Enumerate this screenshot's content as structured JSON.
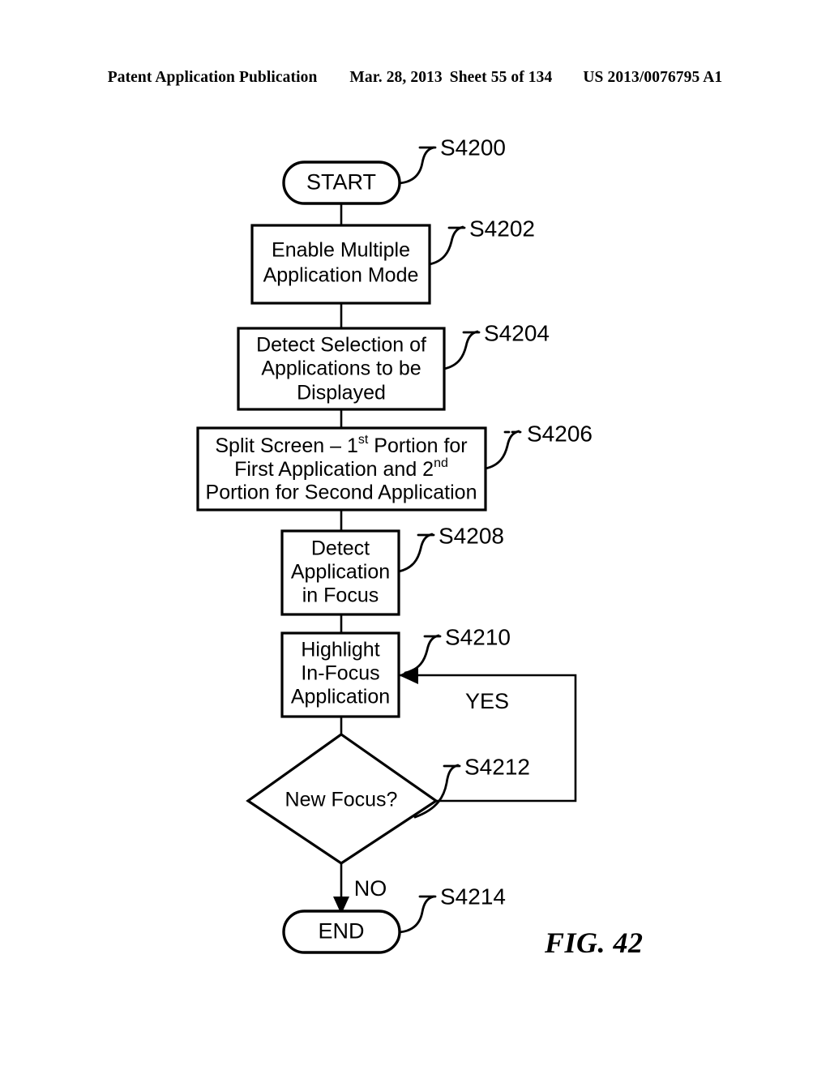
{
  "header": {
    "publication": "Patent Application Publication",
    "date": "Mar. 28, 2013",
    "sheet": "Sheet 55 of 134",
    "patent_number": "US 2013/0076795 A1"
  },
  "figure": {
    "caption": "FIG. 42"
  },
  "flowchart": {
    "nodes": {
      "start": {
        "label": "START",
        "step": "S4200"
      },
      "enable_mode": {
        "line1": "Enable Multiple",
        "line2": "Application Mode",
        "step": "S4202"
      },
      "detect_selection": {
        "line1": "Detect Selection of",
        "line2": "Applications to be",
        "line3": "Displayed",
        "step": "S4204"
      },
      "split_screen": {
        "line1_a": "Split Screen ",
        "line1_b": "– 1",
        "line1_sup": "st",
        "line1_c": " Portion for",
        "line2_a": "First Application and 2",
        "line2_sup": "nd",
        "line3": "Portion for Second Application",
        "step": "S4206"
      },
      "detect_focus": {
        "line1": "Detect",
        "line2": "Application",
        "line3": "in Focus",
        "step": "S4208"
      },
      "highlight_focus": {
        "line1": "Highlight",
        "line2": "In-Focus",
        "line3": "Application",
        "step": "S4210"
      },
      "new_focus": {
        "label": "New Focus?",
        "step": "S4212"
      },
      "end": {
        "label": "END",
        "step": "S4214"
      }
    },
    "branches": {
      "yes": "YES",
      "no": "NO"
    },
    "colors": {
      "ink": "#000000",
      "paper": "#ffffff"
    }
  }
}
